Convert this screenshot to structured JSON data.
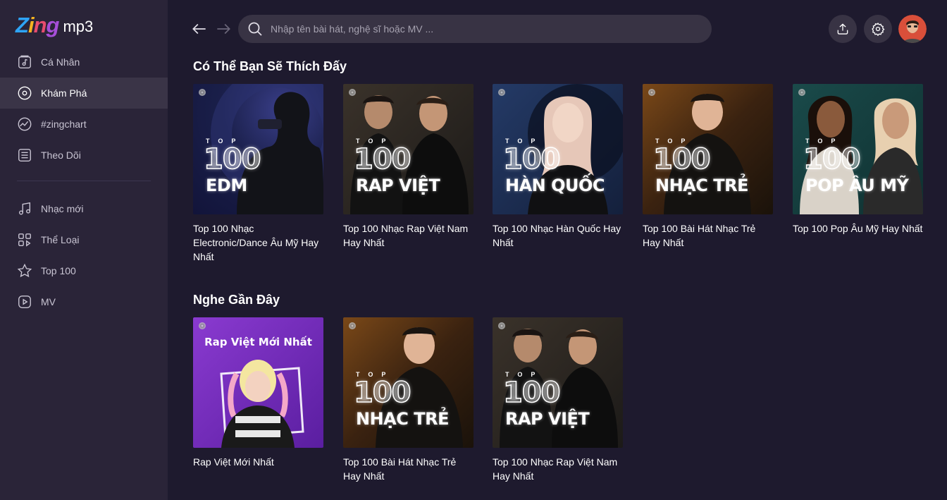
{
  "logo": {
    "brand": "Zing",
    "product": "mp3"
  },
  "sidebar": {
    "primary": [
      {
        "label": "Cá Nhân",
        "icon": "music-library-icon"
      },
      {
        "label": "Khám Phá",
        "icon": "disc-icon",
        "active": true
      },
      {
        "label": "#zingchart",
        "icon": "chart-icon"
      },
      {
        "label": "Theo Dõi",
        "icon": "feed-icon"
      }
    ],
    "secondary": [
      {
        "label": "Nhạc mới",
        "icon": "music-note-icon"
      },
      {
        "label": "Thể Loại",
        "icon": "category-icon"
      },
      {
        "label": "Top 100",
        "icon": "star-icon"
      },
      {
        "label": "MV",
        "icon": "video-icon"
      }
    ]
  },
  "header": {
    "search_placeholder": "Nhập tên bài hát, nghệ sĩ hoặc MV ..."
  },
  "sections": [
    {
      "title": "Có Thể Bạn Sẽ Thích Đấy",
      "cards": [
        {
          "caption": "Top 100 Nhạc Electronic/Dance Âu Mỹ Hay Nhất",
          "art_top": "TOP",
          "art_num": "100",
          "art_genre": "EDM",
          "bg": "#1a1f4a"
        },
        {
          "caption": "Top 100 Nhạc Rap Việt Nam Hay Nhất",
          "art_top": "TOP",
          "art_num": "100",
          "art_genre": "RAP VIỆT",
          "bg": "#2a2420"
        },
        {
          "caption": "Top 100 Nhạc Hàn Quốc Hay Nhất",
          "art_top": "TOP",
          "art_num": "100",
          "art_genre": "HÀN QUỐC",
          "bg": "#1c2a4a"
        },
        {
          "caption": "Top 100 Bài Hát Nhạc Trẻ Hay Nhất",
          "art_top": "TOP",
          "art_num": "100",
          "art_genre": "NHẠC TRẺ",
          "bg": "#3a2210"
        },
        {
          "caption": "Top 100 Pop Âu Mỹ Hay Nhất",
          "art_top": "TOP",
          "art_num": "100",
          "art_genre": "POP ÂU MỸ",
          "bg": "#0f3a3a"
        }
      ]
    },
    {
      "title": "Nghe Gần Đây",
      "cards": [
        {
          "caption": "Rap Việt Mới Nhất",
          "art_title": "Rap Việt Mới Nhất",
          "bg": "#6a2bb0"
        },
        {
          "caption": "Top 100 Bài Hát Nhạc Trẻ Hay Nhất",
          "art_top": "TOP",
          "art_num": "100",
          "art_genre": "NHẠC TRẺ",
          "bg": "#3a2210"
        },
        {
          "caption": "Top 100 Nhạc Rap Việt Nam Hay Nhất",
          "art_top": "TOP",
          "art_num": "100",
          "art_genre": "RAP VIỆT",
          "bg": "#2a2420"
        }
      ]
    }
  ],
  "colors": {
    "background": "#1e1a2e",
    "sidebar": "#2a2438",
    "active_item": "#3a3447",
    "search_bg": "#383344"
  }
}
